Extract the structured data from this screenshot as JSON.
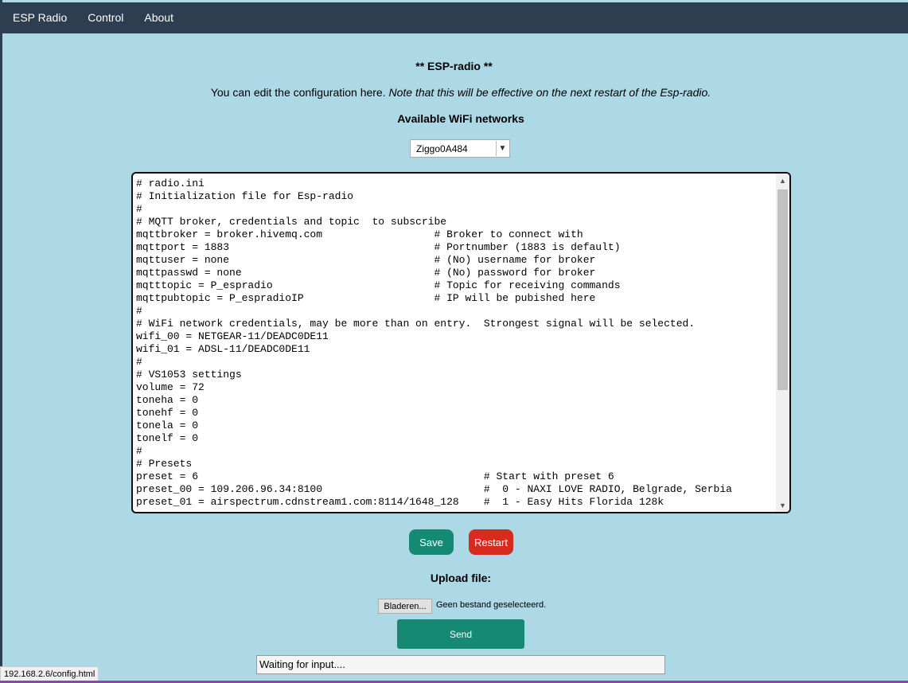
{
  "nav": {
    "items": [
      {
        "label": "ESP Radio"
      },
      {
        "label": "Control"
      },
      {
        "label": "About"
      }
    ]
  },
  "page": {
    "title": "** ESP-radio **",
    "intro_plain": "You can edit the configuration here. ",
    "intro_italic": "Note that this will be effective on the next restart of the Esp-radio.",
    "wifi_heading": "Available WiFi networks"
  },
  "wifi_select": {
    "selected": "Ziggo0A484"
  },
  "config_text": "# radio.ini\n# Initialization file for Esp-radio\n#\n# MQTT broker, credentials and topic  to subscribe\nmqttbroker = broker.hivemq.com                  # Broker to connect with\nmqttport = 1883                                 # Portnumber (1883 is default)\nmqttuser = none                                 # (No) username for broker\nmqttpasswd = none                               # (No) password for broker\nmqtttopic = P_espradio                          # Topic for receiving commands\nmqttpubtopic = P_espradioIP                     # IP will be pubished here\n#\n# WiFi network credentials, may be more than on entry.  Strongest signal will be selected.\nwifi_00 = NETGEAR-11/DEADC0DE11\nwifi_01 = ADSL-11/DEADC0DE11\n#\n# VS1053 settings\nvolume = 72\ntoneha = 0\ntonehf = 0\ntonela = 0\ntonelf = 0\n#\n# Presets\npreset = 6                                              # Start with preset 6\npreset_00 = 109.206.96.34:8100                          #  0 - NAXI LOVE RADIO, Belgrade, Serbia\npreset_01 = airspectrum.cdnstream1.com:8114/1648_128    #  1 - Easy Hits Florida 128k",
  "buttons": {
    "save": "Save",
    "restart": "Restart",
    "send": "Send",
    "browse": "Bladeren..."
  },
  "upload": {
    "heading": "Upload file:",
    "file_status": "Geen bestand geselecteerd."
  },
  "result_text": "Waiting for input....",
  "status_bar_url": "192.168.2.6/config.html",
  "colors": {
    "background": "#add8e6",
    "navbar": "#2c3e50",
    "save": "#148a75",
    "restart": "#d72b1f",
    "send": "#148a75"
  }
}
